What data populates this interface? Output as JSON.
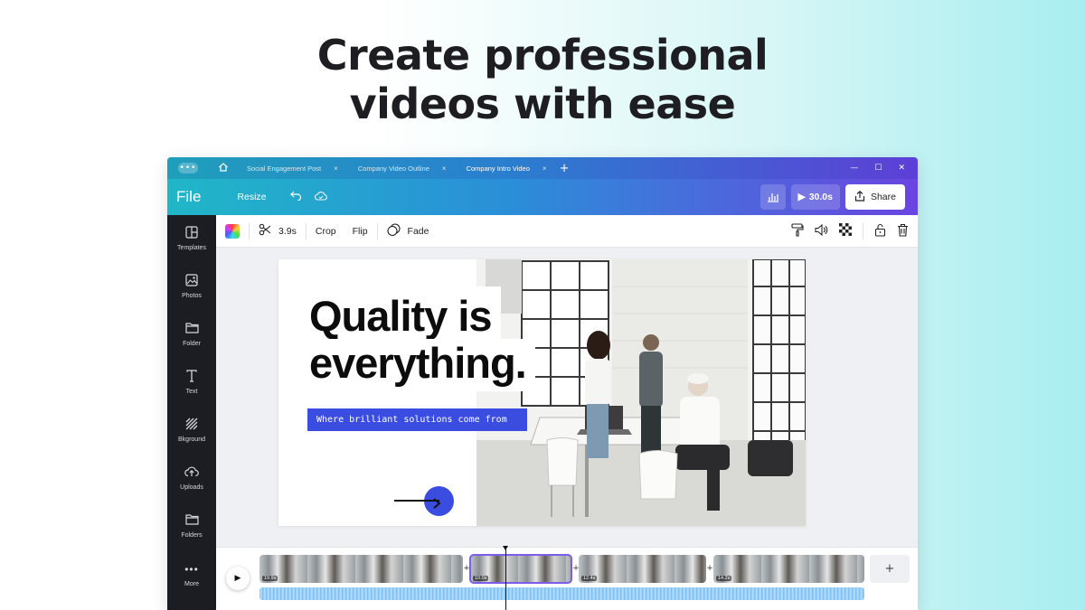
{
  "hero": {
    "line1": "Create professional",
    "line2": "videos with ease"
  },
  "titlebar": {
    "tabs": [
      {
        "label": "Social Engagement Post",
        "active": false
      },
      {
        "label": "Company Video Outline",
        "active": false
      },
      {
        "label": "Company Intro Video",
        "active": true
      }
    ],
    "close_glyph": "×",
    "add_glyph": "+"
  },
  "toolbar": {
    "file_label": "File",
    "resize_label": "Resize",
    "duration_label": "30.0s",
    "share_label": "Share"
  },
  "sidebar": {
    "items": [
      {
        "label": "Templates",
        "icon": "templates-icon"
      },
      {
        "label": "Photos",
        "icon": "photos-icon"
      },
      {
        "label": "Folder",
        "icon": "folder-icon"
      },
      {
        "label": "Text",
        "icon": "text-icon"
      },
      {
        "label": "Bkground",
        "icon": "background-icon"
      },
      {
        "label": "Uploads",
        "icon": "uploads-icon"
      },
      {
        "label": "Folders",
        "icon": "folders-icon"
      },
      {
        "label": "More",
        "icon": "more-icon"
      }
    ]
  },
  "context": {
    "clip_duration": "3.9s",
    "crop_label": "Crop",
    "flip_label": "Flip",
    "fade_label": "Fade"
  },
  "slide": {
    "headline_line1": "Quality is",
    "headline_line2": "everything.",
    "subtitle": "Where brilliant solutions come from",
    "accent_color": "#3b4de0"
  },
  "timeline": {
    "clips": [
      {
        "time": "19.9s",
        "active": false
      },
      {
        "time": "10.0s",
        "active": true
      },
      {
        "time": "12.4s",
        "active": false
      },
      {
        "time": "14.2s",
        "active": false
      }
    ],
    "add_label": "+"
  },
  "colors": {
    "header_gradient_start": "#20b7c8",
    "header_gradient_end": "#6a45e0",
    "sidebar_bg": "#1b1d22",
    "selection": "#7c5ce8"
  }
}
